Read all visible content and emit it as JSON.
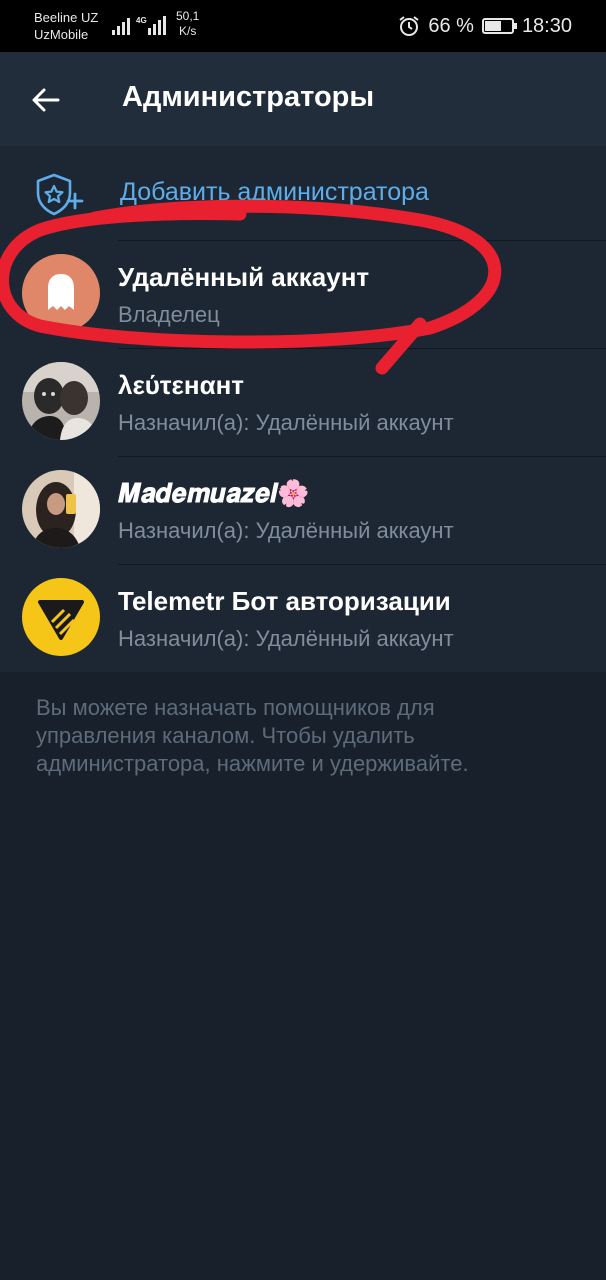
{
  "status_bar": {
    "carrier_1": "Beeline UZ",
    "carrier_2": "UzMobile",
    "net_badge": "4G",
    "speed_value": "50,1",
    "speed_unit": "K/s",
    "battery_text": "66 %",
    "battery_level": 0.66,
    "time": "18:30",
    "icons": [
      "signal-icon",
      "alarm-icon",
      "battery-icon"
    ]
  },
  "header": {
    "title": "Администраторы",
    "back_icon": "arrow-left-icon"
  },
  "add_admin": {
    "label": "Добавить администратора",
    "icon": "shield-star-add-icon"
  },
  "admins": [
    {
      "name": "Удалённый аккаунт",
      "subtitle": "Владелец",
      "avatar": "ghost-icon",
      "avatar_color": "#e0876a"
    },
    {
      "name": "λεύτεнαнт",
      "subtitle": "Назначил(а): Удалённый аккаунт",
      "avatar": "photo"
    },
    {
      "name": "𝑴𝒂𝒅𝒆𝒎𝒖𝒂𝒛𝒆𝒍🌸",
      "subtitle": "Назначил(а): Удалённый аккаунт",
      "avatar": "photo"
    },
    {
      "name": "Telemetr Бот авторизации",
      "subtitle": "Назначил(а): Удалённый аккаунт",
      "avatar": "telemetr-logo-icon",
      "avatar_color": "#f5c518"
    }
  ],
  "footer_text": "Вы можете назначать помощников для управления каналом. Чтобы удалить администратора, нажмите и удерживайте.",
  "colors": {
    "accent": "#5eadea",
    "background": "#18202b",
    "list_background": "#1d2733",
    "annotation": "#e8202f"
  }
}
